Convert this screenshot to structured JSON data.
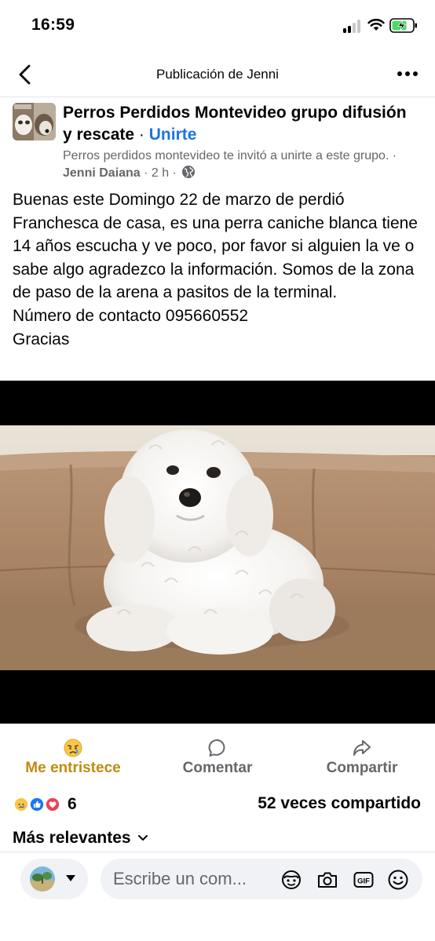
{
  "status_bar": {
    "time": "16:59"
  },
  "header": {
    "title": "Publicación de Jenni"
  },
  "post": {
    "group_name": "Perros Perdidos Montevideo grupo difusión y rescate",
    "separator": " · ",
    "join_label": "Unirte",
    "invite_text": "Perros perdidos montevideo te invitó a unirte a este grupo. · ",
    "author": "Jenni Daiana",
    "time_ago": " · 2 h · ",
    "body": "Buenas este Domingo 22 de marzo de perdió Franchesca de casa, es una perra caniche blanca  tiene 14 años escucha y ve poco, por favor si alguien la ve o sabe algo agradezco la información. Somos de la zona de paso de la arena a pasitos de la terminal.\nNúmero de contacto 095660552\nGracias"
  },
  "actions": {
    "react_label": "Me entristece",
    "comment_label": "Comentar",
    "share_label": "Compartir"
  },
  "stats": {
    "reaction_count": "6",
    "shares_text": "52 veces compartido"
  },
  "comments": {
    "sort_label": "Más relevantes"
  },
  "composer": {
    "placeholder": "Escribe un com..."
  },
  "colors": {
    "accent": "#1b74e4",
    "sad_reaction": "#c18b10",
    "secondary_text": "#65676b"
  }
}
